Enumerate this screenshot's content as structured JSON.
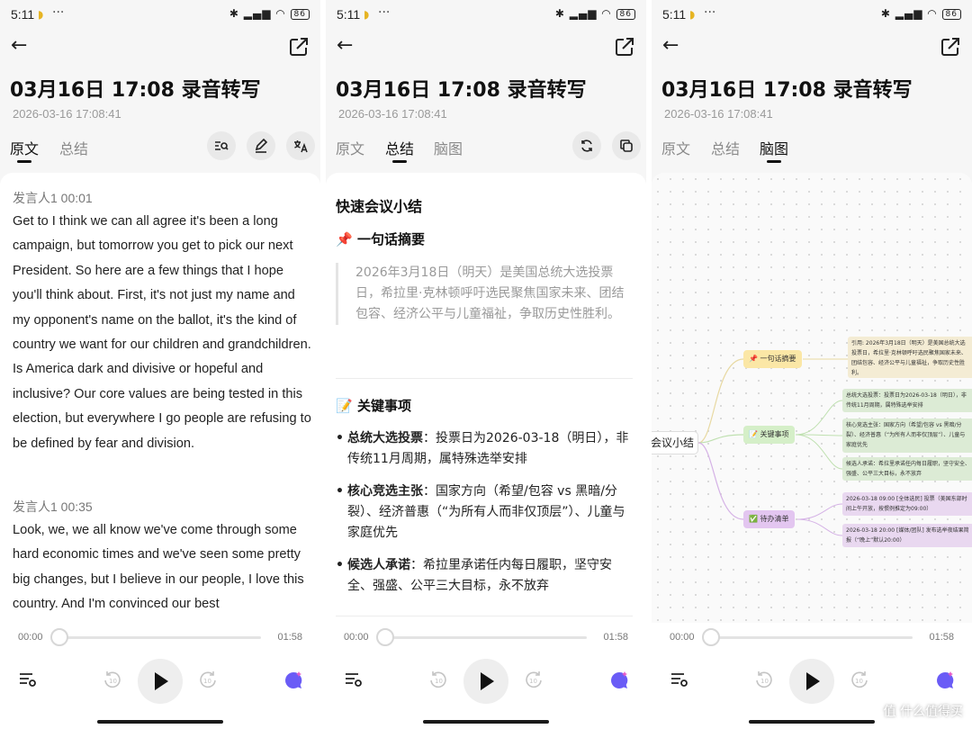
{
  "status": {
    "time": "5:11",
    "battery": "86"
  },
  "header": {
    "title": "03月16日 17:08 录音转写",
    "datetime": "2026-03-16 17:08:41"
  },
  "tabs": {
    "original": "原文",
    "summary": "总结",
    "mindmap": "脑图"
  },
  "transcript": [
    {
      "speaker": "发言人1 00:01",
      "text": "Get to I think we can all agree it's been a long campaign, but tomorrow you get to pick our next President. So here are a few things that I hope you'll think about. First, it's not just my name and my opponent's name on the ballot, it's the kind of country we want for our children and grandchildren. Is America dark and divisive or hopeful and inclusive? Our core values are being tested in this election, but everywhere I go people are refusing to be defined by fear and division."
    },
    {
      "speaker": "发言人1 00:35",
      "text": "Look, we, we all know we've come through some hard economic times and we've seen some pretty big changes, but I believe in our people, I love this country. And I'm convinced our best"
    }
  ],
  "summary": {
    "heading": "快速会议小结",
    "one_line": {
      "title": "一句话摘要",
      "text": "2026年3月18日（明天）是美国总统大选投票日，希拉里·克林顿呼吁选民聚焦国家未来、团结包容、经济公平与儿童福祉，争取历史性胜利。"
    },
    "key_items": {
      "title": "关键事项",
      "items": [
        {
          "label": "总统大选投票",
          "text": "：投票日为2026-03-18（明日），非传统11月周期，属特殊选举安排"
        },
        {
          "label": "核心竞选主张",
          "text": "：国家方向（希望/包容 vs 黑暗/分裂）、经济普惠（“为所有人而非仅顶层”）、儿童与家庭优先"
        },
        {
          "label": "候选人承诺",
          "text": "：希拉里承诺任内每日履职，坚守安全、强盛、公平三大目标，永不放弃"
        }
      ]
    }
  },
  "mindmap": {
    "root": "会议小结",
    "branches": [
      {
        "label": "一句话摘要",
        "color": "#fbe7a6",
        "leaves": [
          "引用: 2026年3月18日（明天）是美国总统大选投票日，希拉里·克林顿呼吁选民聚焦国家未来、团结包容、经济公平与儿童福祉，争取历史性胜利。"
        ],
        "leaf_color": "#f4ecd4"
      },
      {
        "label": "关键事项",
        "color": "#d5efc8",
        "leaves": [
          "总统大选投票：投票日为2026-03-18（明日），非传统11月周期，属特殊选举安排",
          "核心竞选主张：国家方向（希望/包容 vs 黑暗/分裂）、经济普惠（“为所有人而非仅顶层”）、儿童与家庭优先",
          "候选人承诺：希拉里承诺任内每日履职，坚守安全、强盛、公平三大目标，永不放弃"
        ],
        "leaf_color": "#dcebd5"
      },
      {
        "label": "待办清单",
        "color": "#e3c6f0",
        "leaves": [
          "2026-03-18 09:00 [全体选民] 投票（美国东部时间上午开放，按惯例推定为09:00）",
          "2026-03-18 20:00 [媒体/团队] 发布选举夜结果简报（“晚上”默认20:00）"
        ],
        "leaf_color": "#e9d8f0"
      }
    ]
  },
  "player": {
    "current": "00:00",
    "total": "01:58",
    "progress": 0
  },
  "watermark": "值 什么值得买",
  "colors": {
    "accent": "#111111",
    "muted": "#8a8a8a",
    "assistant": "#6a5cf6"
  }
}
